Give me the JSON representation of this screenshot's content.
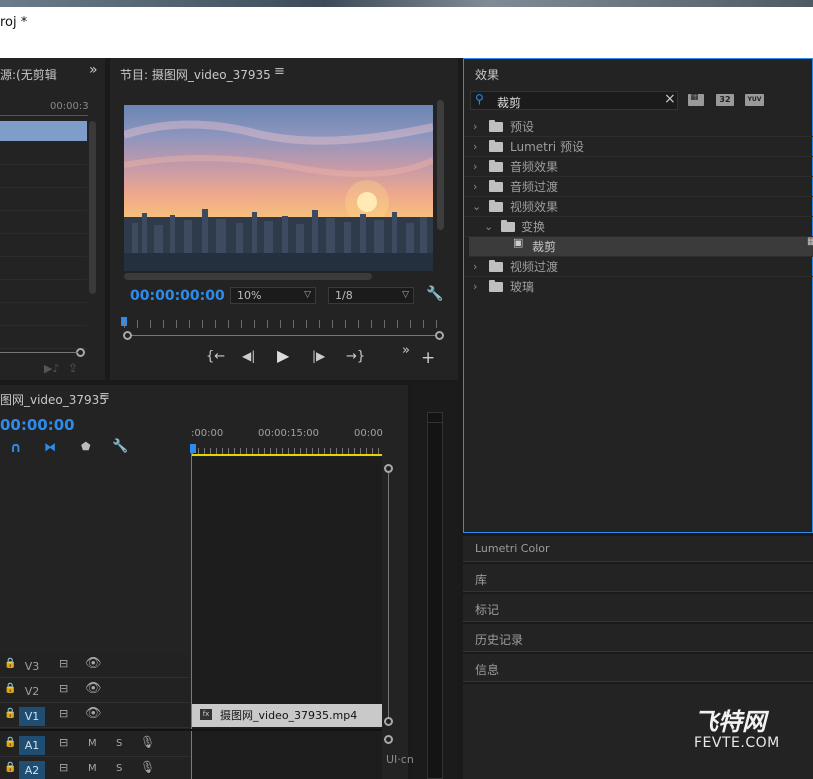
{
  "window": {
    "title": "roj *"
  },
  "source_panel": {
    "title": "源:(无剪辑",
    "timecode": "00:00:3",
    "expand": "»"
  },
  "program_panel": {
    "title": "节目: 摄图网_video_37935",
    "menu_icon": "≡",
    "timecode": "00:00:00:00",
    "zoom": "10%",
    "resolution": "1/8",
    "expand": "»",
    "add": "+"
  },
  "timeline_panel": {
    "title": "图网_video_37935",
    "menu_icon": "≡",
    "timecode": "00:00:00",
    "ruler": [
      ":00:00",
      "00:00:15:00",
      "00:00"
    ],
    "tracks": [
      {
        "name": "V3",
        "active": false,
        "type": "video"
      },
      {
        "name": "V2",
        "active": false,
        "type": "video"
      },
      {
        "name": "V1",
        "active": true,
        "type": "video"
      },
      {
        "name": "A1",
        "active": true,
        "type": "audio",
        "m": "M",
        "s": "S"
      },
      {
        "name": "A2",
        "active": true,
        "type": "audio",
        "m": "M",
        "s": "S"
      }
    ],
    "clip": {
      "name": "摄图网_video_37935.mp4",
      "badge": "fx"
    }
  },
  "effects_panel": {
    "title": "效果",
    "search_value": "裁剪",
    "clear_icon": "×",
    "badge_32": "32",
    "badge_yuv": "YUV",
    "tree": [
      {
        "label": "预设",
        "level": 0,
        "icon": "preset-folder",
        "expanded": false
      },
      {
        "label": "Lumetri 预设",
        "level": 0,
        "icon": "preset-folder",
        "expanded": false
      },
      {
        "label": "音频效果",
        "level": 0,
        "icon": "folder",
        "expanded": false
      },
      {
        "label": "音频过渡",
        "level": 0,
        "icon": "folder",
        "expanded": false
      },
      {
        "label": "视频效果",
        "level": 0,
        "icon": "folder",
        "expanded": true
      },
      {
        "label": "变换",
        "level": 1,
        "icon": "folder",
        "expanded": true
      },
      {
        "label": "裁剪",
        "level": 2,
        "icon": "effect",
        "selected": true
      },
      {
        "label": "视频过渡",
        "level": 0,
        "icon": "folder",
        "expanded": false
      },
      {
        "label": "玻璃",
        "level": 0,
        "icon": "folder",
        "expanded": false
      }
    ]
  },
  "side_panels": [
    "Lumetri Color",
    "库",
    "标记",
    "历史记录",
    "信息"
  ],
  "watermark": {
    "brand": "飞特网",
    "domain": "FEVTE.COM",
    "uicn": "UI·cn"
  }
}
